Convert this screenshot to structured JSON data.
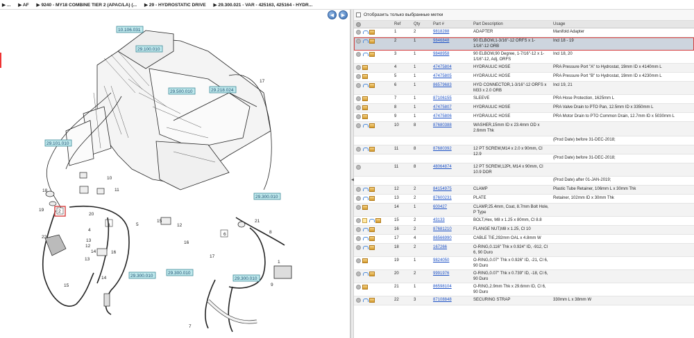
{
  "breadcrumb": {
    "items": [
      "▶ ...",
      "▶ AF",
      "▶ 9240 - MY18 COMBINE TIER 2 (APAC/LA) (...",
      "▶ 29 - HYDROSTATIC DRIVE",
      "▶ 29.300.021 - VAR - 425163, 425164 - HYDR..."
    ]
  },
  "diagram": {
    "nav_prev": "◀",
    "nav_next": "▶",
    "callouts": [
      "10.106.031",
      "29.100.010",
      "29.500.010",
      "29.218.024",
      "29.101.010",
      "29.300.010",
      "29.300.010",
      "29.300.010",
      "29.300.010"
    ],
    "refs": [
      "17",
      "18",
      "19",
      "20",
      "2",
      "3",
      "10",
      "11",
      "16",
      "5",
      "15",
      "12",
      "4",
      "22",
      "21",
      "6",
      "8",
      "9",
      "1",
      "13",
      "14",
      "15",
      "17",
      "7",
      "14",
      "16",
      "12",
      "13"
    ],
    "icons": [
      "engine-illustration",
      "hose-illustration"
    ]
  },
  "filter": {
    "label": "Отобразить только выбранные метки"
  },
  "table": {
    "headers": {
      "ref": "Ref",
      "qty": "Qty",
      "part": "Part #",
      "desc": "Part Description",
      "usage": "Usage"
    },
    "rows": [
      {
        "ref": "1",
        "qty": "2",
        "part": "9818288",
        "desc": "ADAPTER",
        "usage": "Manifold Adapter",
        "icons": "circ,cart,box"
      },
      {
        "ref": "2",
        "qty": "1",
        "part": "9846848",
        "desc": "90 ELBOW,1-3/16\"-12 ORFS x 1-1/16\"-12 ORB",
        "usage": "Incl 18 - 19",
        "icons": "circ,cart,box",
        "selected": true
      },
      {
        "ref": "3",
        "qty": "1",
        "part": "9848958",
        "desc": "90 ELBOW,90 Degree, 1-7/16\"-12 x 1-1/16\"-12, Adj, ORFS",
        "usage": "Incl 18, 20",
        "icons": "circ,cart,box"
      },
      {
        "ref": "4",
        "qty": "1",
        "part": "47475804",
        "desc": "HYDRAULIC HOSE",
        "usage": "PRA Pressure Port \"A\" to Hydrostat, 19mm ID x 4140mm L",
        "icons": "circ,box"
      },
      {
        "ref": "5",
        "qty": "1",
        "part": "47475805",
        "desc": "HYDRAULIC HOSE",
        "usage": "PRA Pressure Port \"B\" to Hydrostat, 19mm ID x 4230mm L",
        "icons": "circ,box"
      },
      {
        "ref": "6",
        "qty": "1",
        "part": "86579683",
        "desc": "HYD CONNECTOR,1-3/16\"-12 ORFS x M33 x 2.0 ORB",
        "usage": "Incl 19, 21",
        "icons": "circ,cart,box"
      },
      {
        "ref": "7",
        "qty": "1",
        "part": "87106155",
        "desc": "SLEEVE",
        "usage": "PRA Hose Protection, 1625mm L",
        "icons": "circ,box"
      },
      {
        "ref": "8",
        "qty": "1",
        "part": "47475807",
        "desc": "HYDRAULIC HOSE",
        "usage": "PRA Valve Drain to PTO Pan, 12.5mm ID x 3350mm L",
        "icons": "circ,box"
      },
      {
        "ref": "9",
        "qty": "1",
        "part": "47475806",
        "desc": "HYDRAULIC HOSE",
        "usage": "PRA Motor Drain to PTO  Common Drain, 12.7mm ID x 5030mm L",
        "icons": "circ,box"
      },
      {
        "ref": "10",
        "qty": "8",
        "part": "87680388",
        "desc": "WASHER,15mm ID x 23.4mm OD x 2.6mm Thk",
        "usage": "",
        "icons": "circ,cart,box"
      },
      {
        "ref": "",
        "qty": "",
        "part": "",
        "desc": "",
        "usage": "(Prod Date) before 31-DEC-2018;",
        "icons": ""
      },
      {
        "ref": "11",
        "qty": "8",
        "part": "87680392",
        "desc": "12 PT SCREW,M14 x 2.0 x 90mm, Cl 12.9",
        "usage": "",
        "icons": "circ,cart,box"
      },
      {
        "ref": "",
        "qty": "",
        "part": "",
        "desc": "",
        "usage": "(Prod Date) before 31-DEC-2018;",
        "icons": ""
      },
      {
        "ref": "11",
        "qty": "8",
        "part": "48064874",
        "desc": "12 PT SCREW,12Pt, M14 x 90mm, Cl 10.9 DOR",
        "usage": "",
        "icons": "circ"
      },
      {
        "ref": "",
        "qty": "",
        "part": "",
        "desc": "",
        "usage": "(Prod Date) after 01-JAN-2019;",
        "icons": ""
      },
      {
        "ref": "12",
        "qty": "2",
        "part": "84154975",
        "desc": "CLAMP",
        "usage": "Plastic Tube Retainer, 106mm L x 30mm Thk",
        "icons": "circ,cart,box"
      },
      {
        "ref": "13",
        "qty": "2",
        "part": "87600231",
        "desc": "PLATE",
        "usage": "Retainer, 102mm ID x 30mm Thk",
        "icons": "circ,cart,box"
      },
      {
        "ref": "14",
        "qty": "1",
        "part": "600427",
        "desc": "CLAMP,25.4mm, Coat, 8.7mm Bolt Hole, P Type",
        "usage": "",
        "icons": "circ,box"
      },
      {
        "ref": "15",
        "qty": "2",
        "part": "43133",
        "desc": "BOLT,Hex, M8 x 1.25 x 80mm, Cl 8.8",
        "usage": "",
        "icons": "circ,note,cart,box"
      },
      {
        "ref": "16",
        "qty": "2",
        "part": "87681210",
        "desc": "FLANGE NUT,M8 x 1.25, Cl 10",
        "usage": "",
        "icons": "circ,cart,box"
      },
      {
        "ref": "17",
        "qty": "4",
        "part": "86566990",
        "desc": "CABLE TIE,292mm OAL x 4.8mm W",
        "usage": "",
        "icons": "circ,cart,box"
      },
      {
        "ref": "18",
        "qty": "2",
        "part": "167266",
        "desc": "O-RING,0.116\" Thk x 0.924\" ID, -912, Cl 6, 90 Duro",
        "usage": "",
        "icons": "circ,cart,box"
      },
      {
        "ref": "19",
        "qty": "1",
        "part": "9824050",
        "desc": "O-RING,0.07\" Thk x 0.926\" ID, -21, Cl 6, 90 Duro",
        "usage": "",
        "icons": "circ,box"
      },
      {
        "ref": "20",
        "qty": "2",
        "part": "9991976",
        "desc": "O-RING,0.07\" Thk x 0.739\" ID, -18, Cl 6, 90 Duro",
        "usage": "",
        "icons": "circ,cart,box"
      },
      {
        "ref": "21",
        "qty": "1",
        "part": "86598104",
        "desc": "O-RING,2.9mm Thk x 29.6mm ID, Cl 6, 90 Duro",
        "usage": "",
        "icons": "circ,box"
      },
      {
        "ref": "22",
        "qty": "3",
        "part": "87108848",
        "desc": "SECURING STRAP",
        "usage": "330mm L x 38mm W",
        "icons": "circ,cart,box"
      }
    ]
  }
}
